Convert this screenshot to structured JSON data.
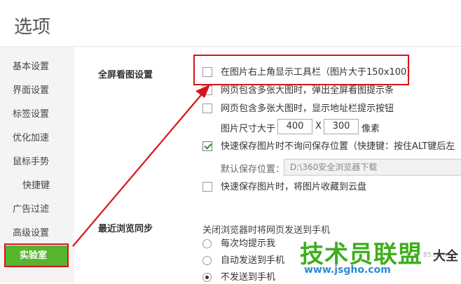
{
  "title": "选项",
  "sidebar": {
    "items": [
      {
        "label": "基本设置"
      },
      {
        "label": "界面设置"
      },
      {
        "label": "标签设置"
      },
      {
        "label": "优化加速"
      },
      {
        "label": "鼠标手势"
      },
      {
        "label": "快捷键"
      },
      {
        "label": "广告过滤"
      },
      {
        "label": "高级设置"
      },
      {
        "label": "实验室",
        "active": true
      }
    ]
  },
  "fullscreen": {
    "section_label": "全屏看图设置",
    "opt1": "在图片右上角显示工具栏（图片大于150x100）",
    "opt2": "网页包含多张大图时，弹出全屏看图提示条",
    "opt3": "网页包含多张大图时，显示地址栏提示按钮",
    "size_prefix": "图片尺寸大于",
    "width": "400",
    "x_sep": "X",
    "height": "300",
    "size_unit": "像素",
    "opt4": "快速保存图片时不询问保存位置（快捷键：按住ALT键后左",
    "save_label": "默认保存位置：",
    "save_path": "D:\\360安全浏览器下载",
    "opt5": "快速保存图片时，将图片收藏到云盘"
  },
  "sync": {
    "section_label": "最近浏览同步",
    "desc": "关闭浏览器时将网页发送到手机",
    "r1": "每次均提示我",
    "r2": "自动发送到手机",
    "r3": "不发送到手机"
  },
  "watermark": {
    "big": "技术员联盟",
    "url": "www.jsgho.com",
    "right": "大全",
    "small": "85.com"
  },
  "colors": {
    "accent": "#55b52f",
    "highlight": "#d7141b"
  }
}
